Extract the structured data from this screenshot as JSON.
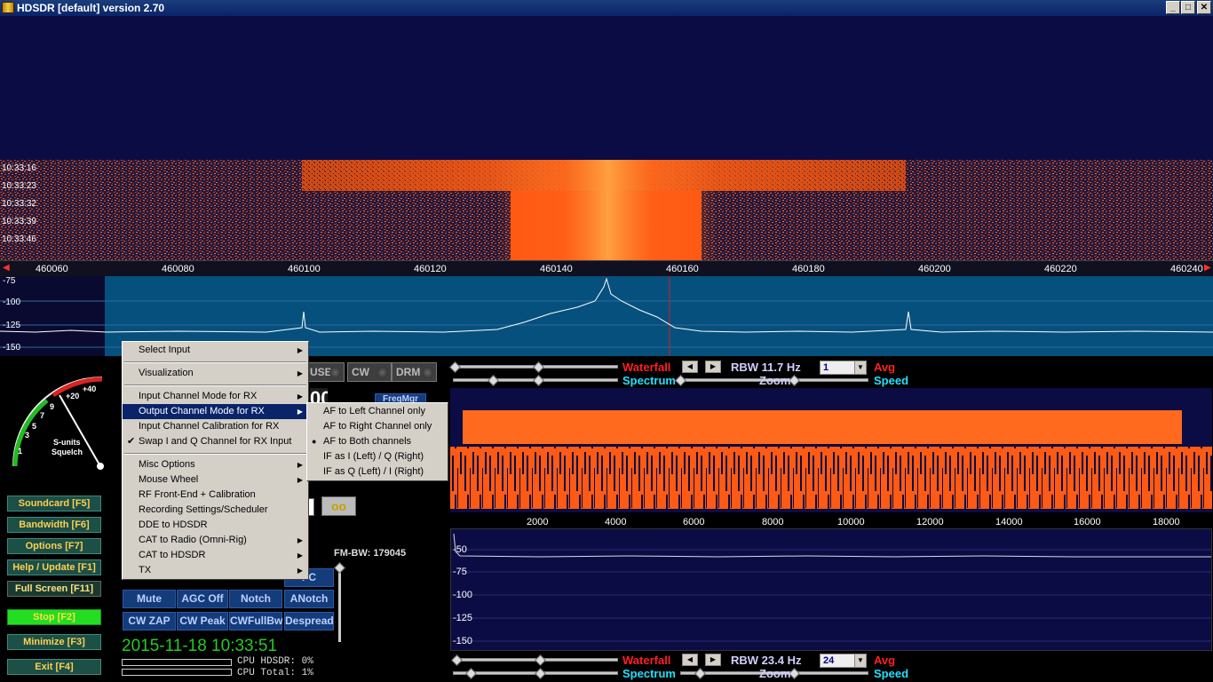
{
  "window": {
    "title": "HDSDR [default]  version 2.70",
    "buttons": [
      "_",
      "□",
      "✕"
    ]
  },
  "waterfall_main": {
    "times": [
      "10:33:16",
      "10:33:23",
      "10:33:32",
      "10:33:39",
      "10:33:46"
    ],
    "freq_ticks": [
      "460060",
      "460080",
      "460100",
      "460120",
      "460140",
      "460160",
      "460180",
      "460200",
      "460220",
      "460240"
    ]
  },
  "spectrum_main": {
    "db_labels": [
      "-75",
      "-100",
      "-125",
      "-150"
    ]
  },
  "context_menu": {
    "items": [
      {
        "label": "Select Input",
        "submenu": true
      },
      {
        "sep": true
      },
      {
        "label": "Visualization",
        "submenu": true
      },
      {
        "sep": true
      },
      {
        "label": "Input Channel Mode for RX",
        "submenu": true
      },
      {
        "label": "Output Channel Mode for RX",
        "submenu": true,
        "highlighted": true
      },
      {
        "label": "Input Channel Calibration for RX"
      },
      {
        "label": "Swap I and Q Channel for RX Input",
        "checked": true
      },
      {
        "sep": true
      },
      {
        "label": "Misc Options",
        "submenu": true
      },
      {
        "label": "Mouse Wheel",
        "submenu": true
      },
      {
        "label": "RF Front-End + Calibration"
      },
      {
        "label": "Recording Settings/Scheduler"
      },
      {
        "label": "DDE to HDSDR"
      },
      {
        "label": "CAT to Radio (Omni-Rig)",
        "submenu": true
      },
      {
        "label": "CAT to HDSDR",
        "submenu": true
      },
      {
        "label": "TX",
        "submenu": true
      }
    ]
  },
  "submenu": {
    "items": [
      {
        "label": "AF to Left Channel only"
      },
      {
        "label": "AF to Right Channel only"
      },
      {
        "label": "AF to Both channels",
        "radio": true
      },
      {
        "label": "IF as I (Left) / Q (Right)"
      },
      {
        "label": "IF as Q (Left) / I (Right)"
      }
    ]
  },
  "smeter": {
    "scale": [
      "1",
      "3",
      "5",
      "7",
      "9",
      "+20",
      "+40"
    ],
    "label1": "S-units",
    "label2": "Squelch"
  },
  "left_buttons": [
    {
      "label": "Soundcard  [F5]"
    },
    {
      "label": "Bandwidth  [F6]"
    },
    {
      "label": "Options  [F7]"
    },
    {
      "label": "Help / Update  [F1]"
    },
    {
      "label": "Full Screen  [F11]"
    },
    {
      "label": "Stop      [F2]"
    },
    {
      "label": "Minimize  [F3]"
    },
    {
      "label": "Exit      [F4]"
    }
  ],
  "modes": [
    "USB",
    "CW",
    "DRM"
  ],
  "freqmgr": "FreqMgr",
  "fmbw": "FM-BW: 179045",
  "dsp_buttons": [
    "Mute",
    "AGC Off",
    "Notch",
    "ANotch",
    "CW ZAP",
    "CW Peak",
    "CWFullBw",
    "Despread"
  ],
  "afc_partial": "FC",
  "clock": "2015-11-18 10:33:51",
  "cpu": {
    "hdsdr": "CPU HDSDR:  0%",
    "total": "CPU Total:  1%"
  },
  "af_panel_top": {
    "waterfall": "Waterfall",
    "spectrum": "Spectrum",
    "zoom": "Zoom",
    "speed": "Speed",
    "rbw": "RBW 11.7 Hz",
    "avg_value": "1",
    "avg": "Avg"
  },
  "af_panel_bottom": {
    "waterfall": "Waterfall",
    "spectrum": "Spectrum",
    "zoom": "Zoom",
    "speed": "Speed",
    "rbw": "RBW 23.4 Hz",
    "avg_value": "24",
    "avg": "Avg"
  },
  "af_freq_ticks": [
    "2000",
    "4000",
    "6000",
    "8000",
    "10000",
    "12000",
    "14000",
    "16000",
    "18000"
  ],
  "af_db_labels": [
    "-50",
    "-75",
    "-100",
    "-125",
    "-150"
  ],
  "colors": {
    "accent_red": "#ff2020",
    "accent_cyan": "#20e0ff",
    "stop_green": "#22dd22",
    "clock_green": "#22cc22"
  }
}
